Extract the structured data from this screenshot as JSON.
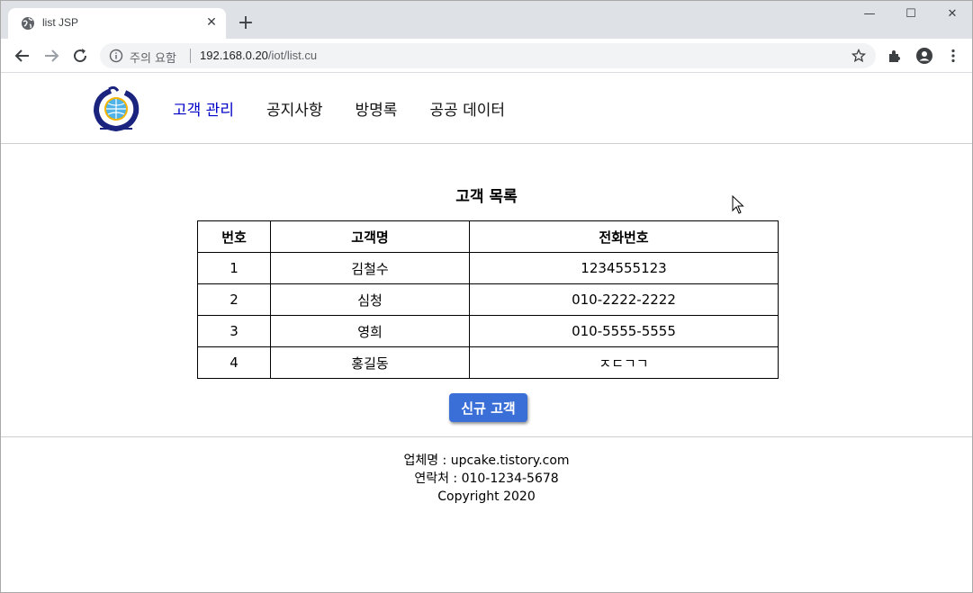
{
  "browser": {
    "tab_title": "list JSP",
    "security_label": "주의 요함",
    "url_host": "192.168.0.20",
    "url_path": "/iot/list.cu"
  },
  "site": {
    "nav": [
      {
        "label": "고객 관리"
      },
      {
        "label": "공지사항"
      },
      {
        "label": "방명록"
      },
      {
        "label": "공공 데이터"
      }
    ],
    "list_title": "고객 목록",
    "table": {
      "headers": [
        "번호",
        "고객명",
        "전화번호"
      ],
      "rows": [
        [
          "1",
          "김철수",
          "1234555123"
        ],
        [
          "2",
          "심청",
          "010-2222-2222"
        ],
        [
          "3",
          "영희",
          "010-5555-5555"
        ],
        [
          "4",
          "홍길동",
          "ㅈㄷㄱㄱ"
        ]
      ]
    },
    "new_button": "신규 고객",
    "footer": {
      "company": "업체명 : upcake.tistory.com",
      "contact": "연락처 : 010-1234-5678",
      "copyright": "Copyright 2020"
    }
  },
  "colors": {
    "active_nav": "#0000c8",
    "button": "#3a6fd8"
  }
}
